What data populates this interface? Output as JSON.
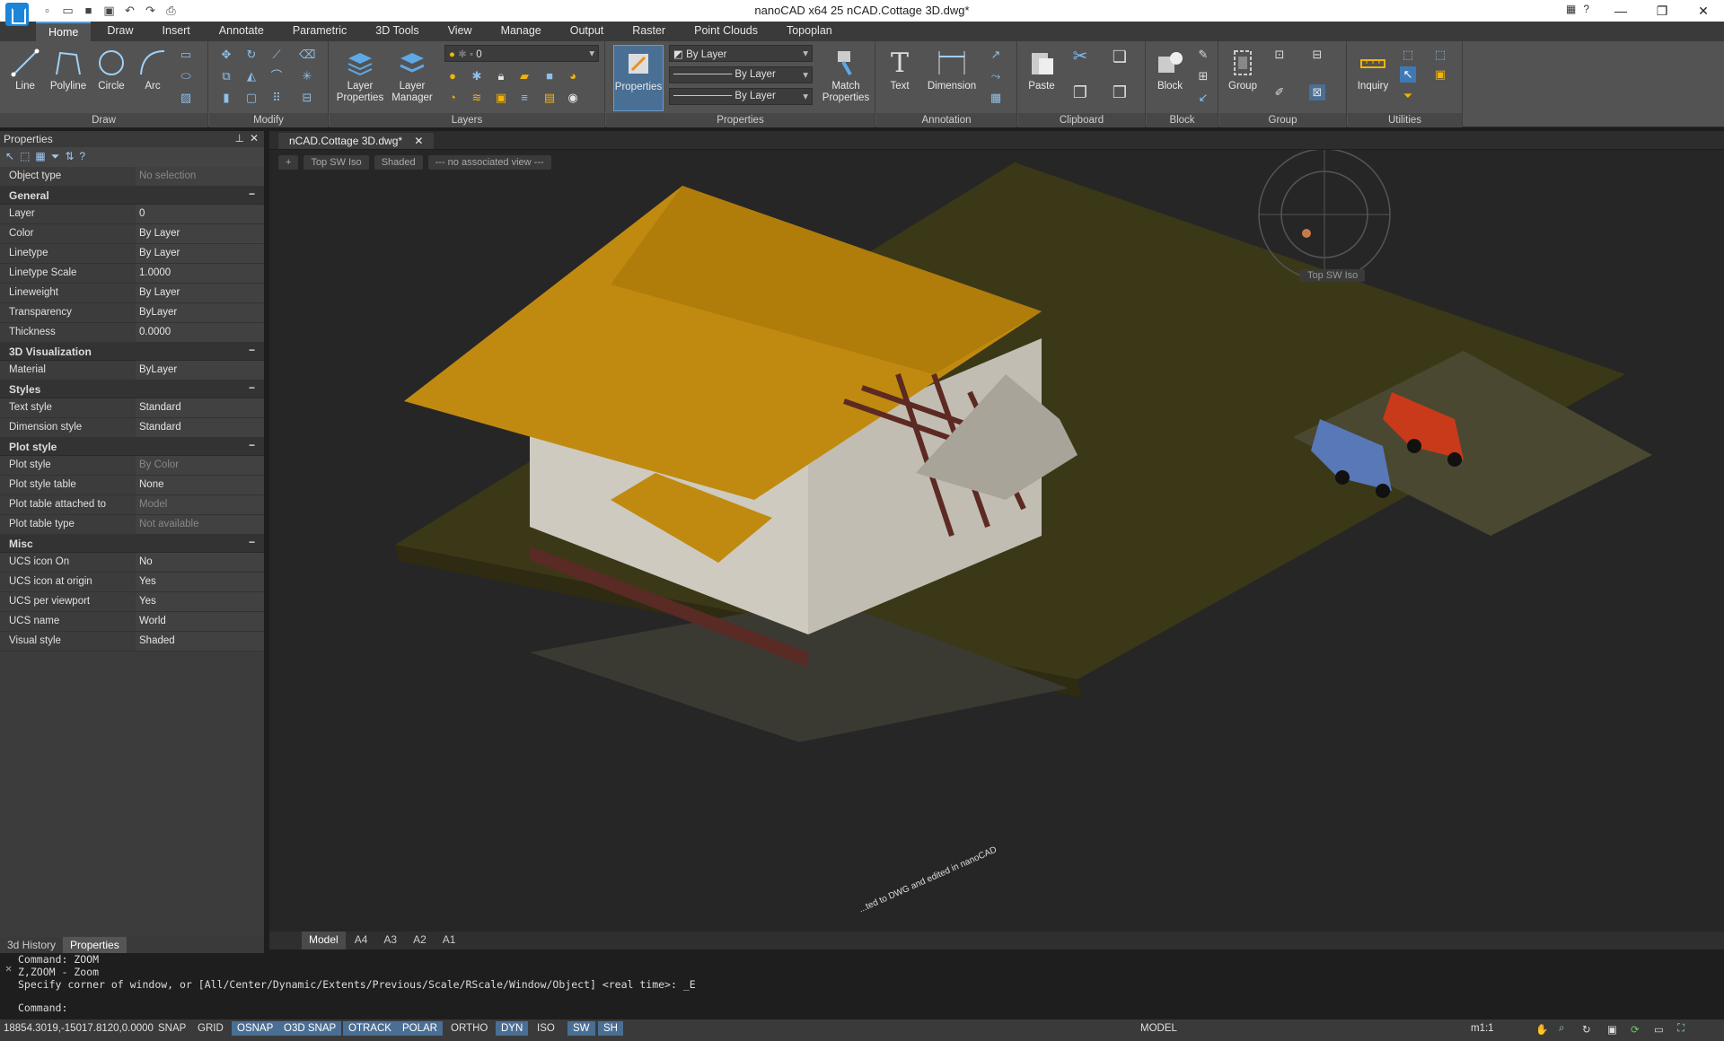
{
  "window": {
    "title": "nanoCAD x64 25 nCAD.Cottage 3D.dwg*"
  },
  "tabs": [
    "Home",
    "Draw",
    "Insert",
    "Annotate",
    "Parametric",
    "3D Tools",
    "View",
    "Manage",
    "Output",
    "Raster",
    "Point Clouds",
    "Topoplan"
  ],
  "ribbon": {
    "draw": {
      "label": "Draw",
      "line": "Line",
      "polyline": "Polyline",
      "circle": "Circle",
      "arc": "Arc"
    },
    "modify": {
      "label": "Modify"
    },
    "layers": {
      "label": "Layers",
      "layer_props": "Layer Properties",
      "layer_manager": "Layer Manager",
      "current_layer": "0"
    },
    "properties": {
      "label": "Properties",
      "properties_btn": "Properties",
      "match": "Match Properties",
      "color": "By Layer",
      "linetype": "By Layer",
      "lineweight": "By Layer"
    },
    "annotation": {
      "label": "Annotation",
      "text": "Text",
      "dimension": "Dimension"
    },
    "clipboard": {
      "label": "Clipboard",
      "paste": "Paste"
    },
    "block": {
      "label": "Block",
      "block": "Block"
    },
    "group": {
      "label": "Group",
      "group": "Group"
    },
    "utilities": {
      "label": "Utilities",
      "inquiry": "Inquiry"
    }
  },
  "properties_panel": {
    "title": "Properties",
    "object_type_key": "Object type",
    "object_type_val": "No selection",
    "cats": {
      "general": "General",
      "vis": "3D Visualization",
      "styles": "Styles",
      "plot": "Plot style",
      "misc": "Misc"
    },
    "general": [
      {
        "k": "Layer",
        "v": "0"
      },
      {
        "k": "Color",
        "v": "By Layer"
      },
      {
        "k": "Linetype",
        "v": "By Layer"
      },
      {
        "k": "Linetype Scale",
        "v": "1.0000"
      },
      {
        "k": "Lineweight",
        "v": "By Layer"
      },
      {
        "k": "Transparency",
        "v": "ByLayer"
      },
      {
        "k": "Thickness",
        "v": "0.0000"
      }
    ],
    "vis": [
      {
        "k": "Material",
        "v": "ByLayer"
      }
    ],
    "styles": [
      {
        "k": "Text style",
        "v": "Standard"
      },
      {
        "k": "Dimension style",
        "v": "Standard"
      }
    ],
    "plot": [
      {
        "k": "Plot style",
        "v": "By Color"
      },
      {
        "k": "Plot style table",
        "v": "None"
      },
      {
        "k": "Plot table attached to",
        "v": "Model"
      },
      {
        "k": "Plot table type",
        "v": "Not available"
      }
    ],
    "misc": [
      {
        "k": "UCS icon On",
        "v": "No"
      },
      {
        "k": "UCS icon at origin",
        "v": "Yes"
      },
      {
        "k": "UCS per viewport",
        "v": "Yes"
      },
      {
        "k": "UCS name",
        "v": "World"
      },
      {
        "k": "Visual style",
        "v": "Shaded"
      }
    ],
    "bottom_tabs": [
      "3d History",
      "Properties"
    ]
  },
  "document": {
    "tab": "nCAD.Cottage 3D.dwg*"
  },
  "viewport": {
    "plus": "+",
    "view": "Top SW Iso",
    "style": "Shaded",
    "assoc": "--- no associated view ---",
    "cube_label": "Top SW Iso",
    "watermark": "...ted to DWG and edited in nanoCAD"
  },
  "layout_tabs": [
    "Model",
    "A4",
    "A3",
    "A2",
    "A1"
  ],
  "command": {
    "line1": "Command: ZOOM",
    "line2": "Z,ZOOM - Zoom",
    "line3": "Specify corner of window, or [All/Center/Dynamic/Extents/Previous/Scale/RScale/Window/Object] <real time>: _E",
    "prompt": "Command:"
  },
  "status": {
    "coords": "18854.3019,-15017.8120,0.0000",
    "toggles": [
      "SNAP",
      "GRID",
      "OSNAP",
      "O3D SNAP",
      "OTRACK",
      "POLAR",
      "ORTHO",
      "DYN",
      "ISO",
      "SW",
      "SH"
    ],
    "model": "MODEL",
    "scale": "m1:1"
  }
}
